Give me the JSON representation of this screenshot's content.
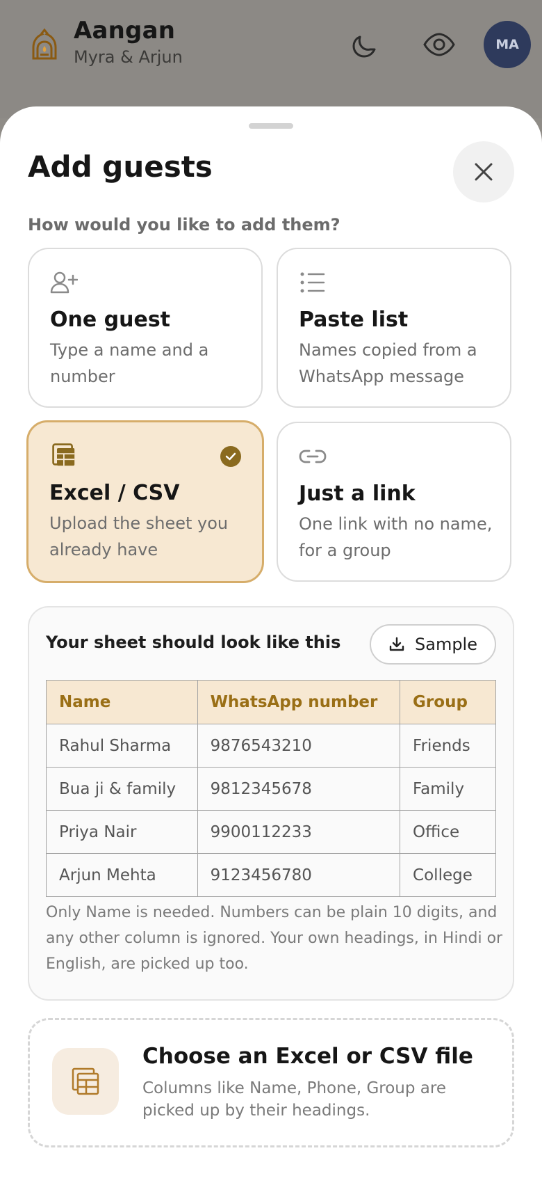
{
  "header": {
    "title": "Aangan",
    "subtitle": "Myra & Arjun",
    "avatar_initials": "MA",
    "icons": {
      "logo": "temple-lamp-icon",
      "theme": "moon-icon",
      "preview": "eye-icon"
    }
  },
  "sheet": {
    "title": "Add guests",
    "question": "How would you like to add them?",
    "options": [
      {
        "title": "One guest",
        "desc": "Type a name and a number",
        "icon": "add-user-icon",
        "selected": false
      },
      {
        "title": "Paste list",
        "desc": "Names copied from a WhatsApp message",
        "icon": "list-icon",
        "selected": false
      },
      {
        "title": "Excel / CSV",
        "desc": "Upload the sheet you already have",
        "icon": "spreadsheet-icon",
        "selected": true
      },
      {
        "title": "Just a link",
        "desc": "One link with no name, for a group",
        "icon": "link-icon",
        "selected": false
      }
    ]
  },
  "sample_info": {
    "title": "Your sheet should look like this",
    "sample_button": "Sample",
    "columns": [
      "Name",
      "WhatsApp number",
      "Group"
    ],
    "rows": [
      [
        "Rahul Sharma",
        "9876543210",
        "Friends"
      ],
      [
        "Bua ji & family",
        "9812345678",
        "Family"
      ],
      [
        "Priya Nair",
        "9900112233",
        "Office"
      ],
      [
        "Arjun Mehta",
        "9123456780",
        "College"
      ]
    ],
    "note": "Only Name is needed. Numbers can be plain 10 digits, and any other column is ignored. Your own headings, in Hindi or English, are picked up too."
  },
  "upload": {
    "title": "Choose an Excel or CSV file",
    "desc": "Columns like Name, Phone, Group are picked up by their headings."
  },
  "colors": {
    "accent": "#8a6a1f",
    "selected_bg": "#f7e8d2",
    "selected_border": "#d6ad6a",
    "header_text": "#9a6f16",
    "avatar_bg": "#2e3a5c"
  }
}
